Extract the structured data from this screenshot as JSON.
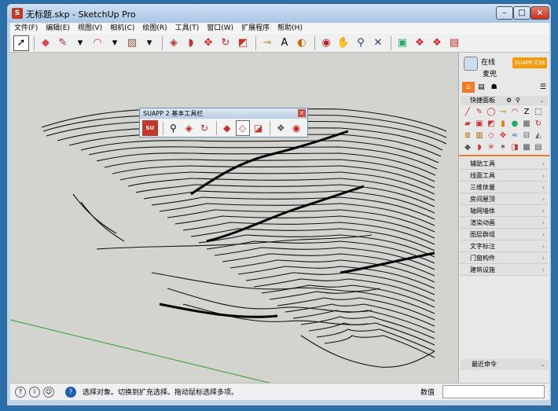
{
  "window": {
    "title": "无标题.skp - SketchUp Pro",
    "close": "×",
    "minimize": "–",
    "maximize": "□"
  },
  "menu": [
    "文件(F)",
    "编辑(E)",
    "视图(V)",
    "相机(C)",
    "绘图(R)",
    "工具(T)",
    "窗口(W)",
    "扩展程序",
    "帮助(H)"
  ],
  "floating_toolbar": {
    "title": "SUAPP 2 基本工具栏",
    "close": "×",
    "logo": "SU"
  },
  "tray": {
    "online": "在线",
    "user": "麦兜",
    "suapp_button": "SUAPP Z38",
    "quick_panel": "快捷面板",
    "recent": "最近命令"
  },
  "categories": [
    "辅助工具",
    "线面工具",
    "三维体量",
    "房间屋顶",
    "轴网墙体",
    "渲染动画",
    "图层群组",
    "文字标注",
    "门窗构件",
    "建筑设施"
  ],
  "status": {
    "message": "选择对象。切换到扩充选择。拖动鼠标选择多项。",
    "measure_label": "数值"
  },
  "colors": {
    "accent": "#f07a28",
    "viewport": "#d3d3cf",
    "axis_green": "#2e9e2e"
  }
}
